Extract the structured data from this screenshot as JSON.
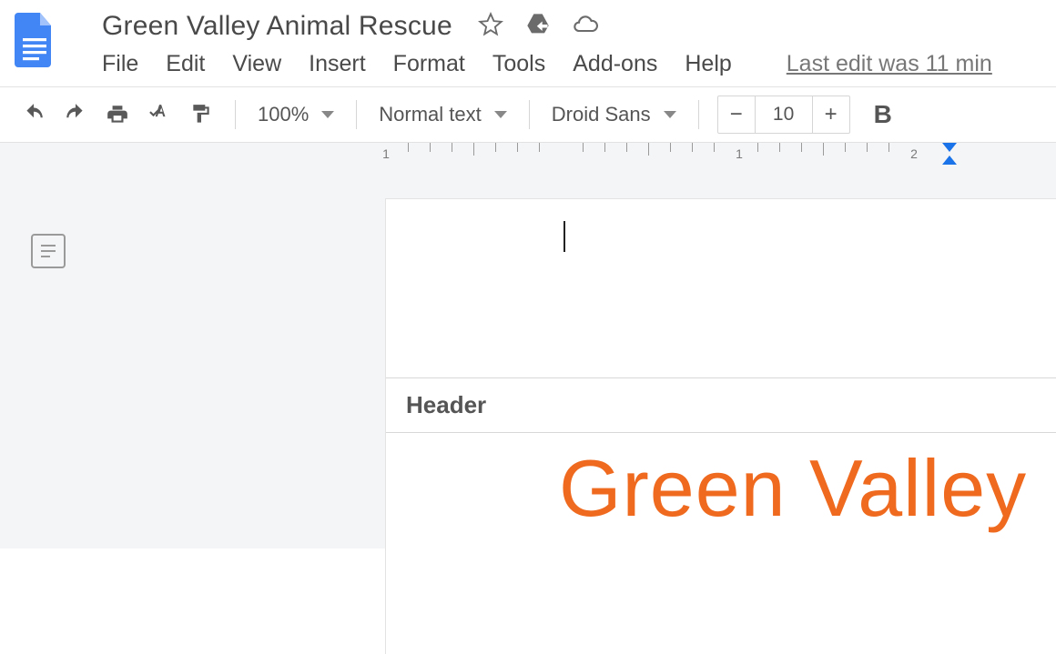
{
  "title": "Green Valley Animal Rescue",
  "menus": [
    "File",
    "Edit",
    "View",
    "Insert",
    "Format",
    "Tools",
    "Add-ons",
    "Help"
  ],
  "last_edit": "Last edit was 11 min",
  "toolbar": {
    "zoom": "100%",
    "style": "Normal text",
    "font": "Droid Sans",
    "fontsize": "10",
    "bold": "B"
  },
  "ruler": {
    "labels": [
      "1",
      "1",
      "2"
    ]
  },
  "page": {
    "header_label": "Header",
    "body_title": "Green Valley"
  }
}
